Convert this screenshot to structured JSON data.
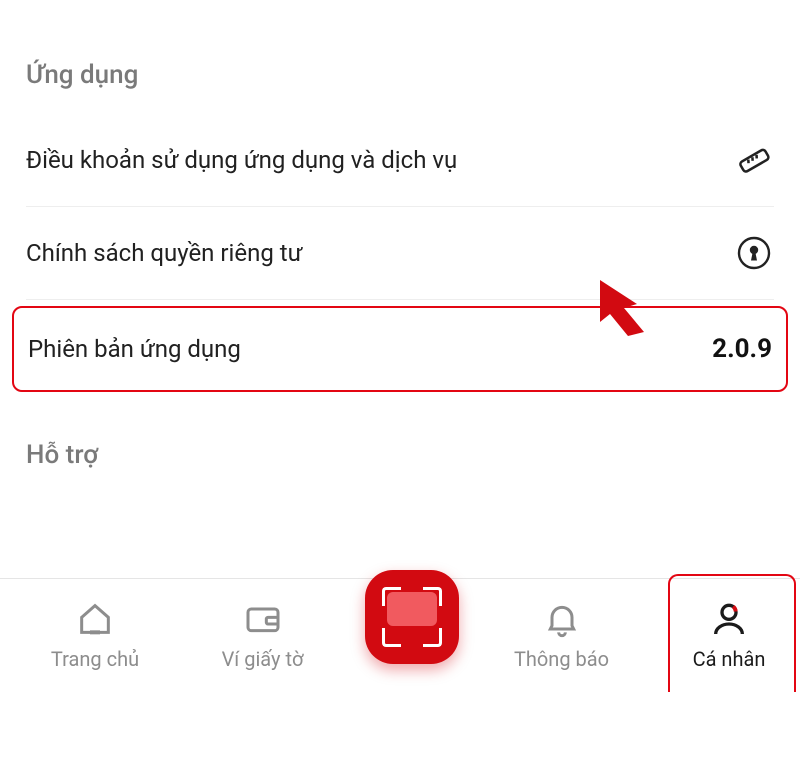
{
  "sections": {
    "app": {
      "title": "Ứng dụng",
      "items": [
        {
          "label": "Điều khoản sử dụng ứng dụng và dịch vụ"
        },
        {
          "label": "Chính sách quyền riêng tư"
        },
        {
          "label": "Phiên bản ứng dụng",
          "value": "2.0.9"
        }
      ]
    },
    "support": {
      "title": "Hỗ trợ"
    }
  },
  "nav": {
    "home": {
      "label": "Trang chủ"
    },
    "wallet": {
      "label": "Ví giấy tờ"
    },
    "scan": {
      "label": ""
    },
    "notify": {
      "label": "Thông báo"
    },
    "profile": {
      "label": "Cá nhân"
    }
  },
  "colors": {
    "accent": "#e30613"
  }
}
